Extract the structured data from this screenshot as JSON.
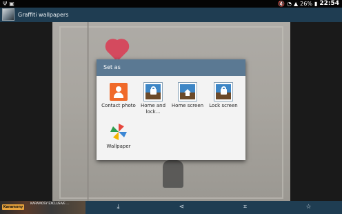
{
  "status_bar": {
    "battery": "26%",
    "time": "22:54",
    "icons": [
      "usb-icon",
      "notification-icon",
      "mute-icon",
      "wifi-icon",
      "signal-icon",
      "battery-icon"
    ]
  },
  "action_bar": {
    "title": "Graffiti wallpapers"
  },
  "dialog": {
    "title": "Set as",
    "options": [
      {
        "label": "Contact photo",
        "icon": "contact-photo-icon"
      },
      {
        "label": "Home and lock...",
        "icon": "home-lock-screen-icon"
      },
      {
        "label": "Home screen",
        "icon": "home-screen-icon"
      },
      {
        "label": "Lock screen",
        "icon": "lock-screen-icon"
      },
      {
        "label": "Wallpaper",
        "icon": "wallpaper-pinwheel-icon"
      }
    ]
  },
  "bottom_bar": {
    "ad": {
      "logo": "Karamony",
      "text": "KARAMOSY EXCLUSIVE ..."
    },
    "actions": [
      "download-icon",
      "share-icon",
      "crop-icon",
      "favorite-star-icon"
    ]
  },
  "colors": {
    "action_bar": "#1f3d52",
    "dialog_header": "#5b7993",
    "contact_orange": "#f06a2a"
  }
}
